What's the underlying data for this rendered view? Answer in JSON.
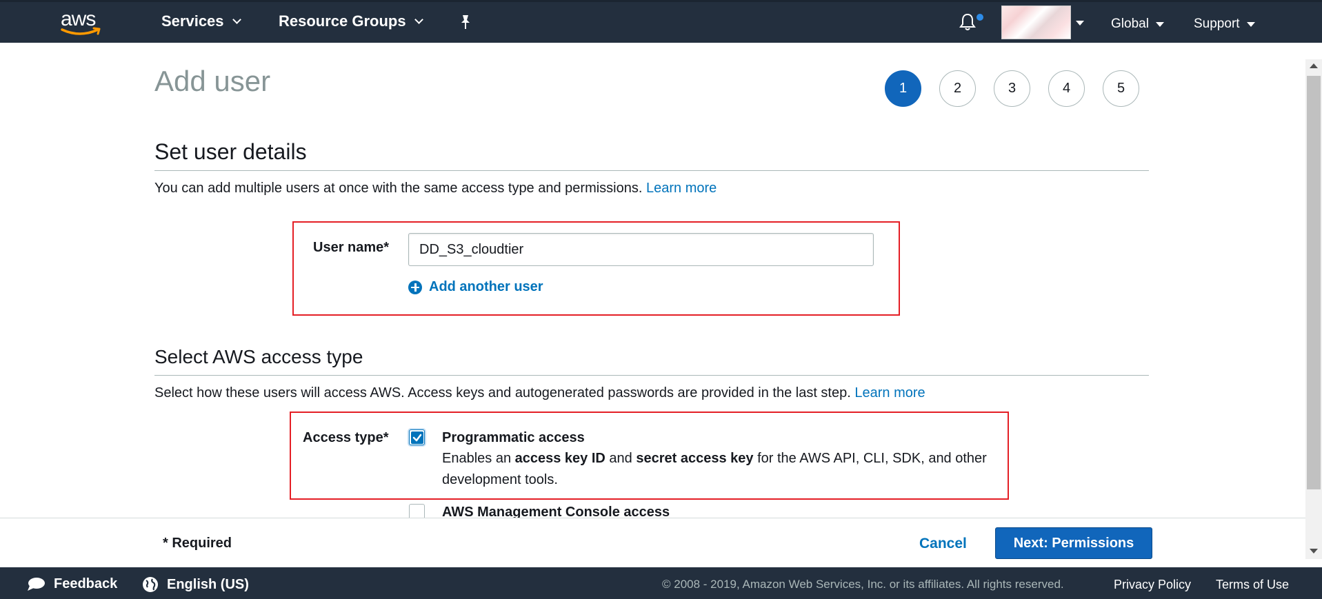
{
  "topnav": {
    "logo_text": "aws",
    "services": "Services",
    "resource_groups": "Resource Groups",
    "region": "Global",
    "support": "Support"
  },
  "page": {
    "title": "Add user",
    "steps": [
      "1",
      "2",
      "3",
      "4",
      "5"
    ],
    "active_step": 1
  },
  "user_details": {
    "section_title": "Set user details",
    "description": "You can add multiple users at once with the same access type and permissions.",
    "learn_more": "Learn more",
    "user_name_label": "User name*",
    "user_name_value": "DD_S3_cloudtier",
    "add_another_user": "Add another user"
  },
  "access_type": {
    "section_title": "Select AWS access type",
    "description": "Select how these users will access AWS. Access keys and autogenerated passwords are provided in the last step.",
    "learn_more": "Learn more",
    "label": "Access type*",
    "programmatic": {
      "title": "Programmatic access",
      "checked": true,
      "desc_1": "Enables an ",
      "desc_bold_1": "access key ID",
      "desc_2": " and ",
      "desc_bold_2": "secret access key",
      "desc_3": " for the AWS API, CLI, SDK, and other development tools."
    },
    "console": {
      "title": "AWS Management Console access",
      "checked": false
    }
  },
  "actions": {
    "required": "* Required",
    "cancel": "Cancel",
    "next": "Next: Permissions"
  },
  "footer": {
    "feedback": "Feedback",
    "language": "English (US)",
    "copyright": "© 2008 - 2019, Amazon Web Services, Inc. or its affiliates. All rights reserved.",
    "privacy": "Privacy Policy",
    "terms": "Terms of Use"
  },
  "colors": {
    "nav_bg": "#232f3e",
    "accent": "#1166bb",
    "link": "#0073bb",
    "highlight_box": "#e41e25"
  }
}
